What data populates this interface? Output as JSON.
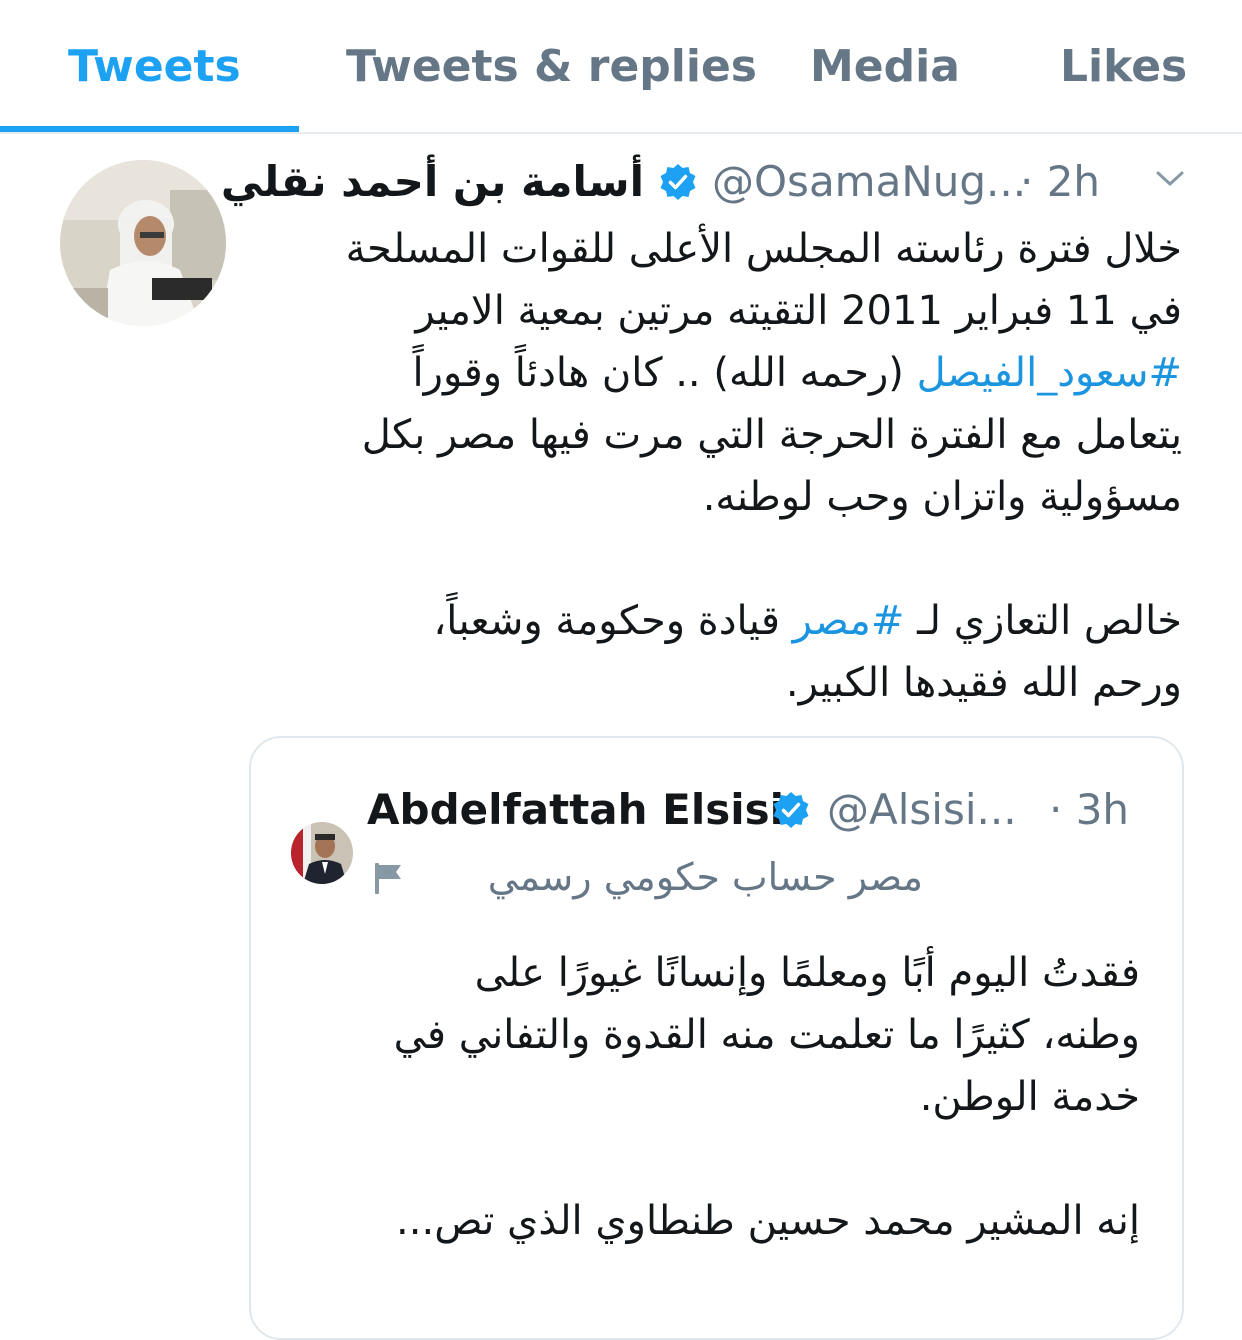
{
  "tabs": [
    {
      "label": "Tweets",
      "active": true
    },
    {
      "label": "Tweets & replies",
      "active": false
    },
    {
      "label": "Media",
      "active": false
    },
    {
      "label": "Likes",
      "active": false
    }
  ],
  "tweet": {
    "author_name": "أسامة بن أحمد نقلي",
    "verified": true,
    "handle": "@OsamaNug...",
    "time": "· 2h",
    "menu_icon": "chevron-down-icon",
    "avatar_icon": "profile-photo",
    "paragraph1": {
      "lines": [
        "خلال فترة رئاسته المجلس الأعلى للقوات المسلحة",
        "في 11 فبراير 2011 التقيته مرتين بمعية الامير"
      ],
      "hashtag": "#سعود_الفيصل",
      "after_hashtag": " (رحمه الله) .. كان هادئاً وقوراً",
      "lines_after": [
        "يتعامل مع الفترة الحرجة التي مرت فيها مصر بكل",
        "مسؤولية واتزان وحب لوطنه."
      ]
    },
    "paragraph2": {
      "before_hashtag": "خالص التعازي لـ ",
      "hashtag": "#مصر",
      "after_hashtag": " قيادة وحكومة وشعباً،",
      "line2": "ورحم الله فقيدها الكبير."
    }
  },
  "quoted_tweet": {
    "author_name": "Abdelfattah Elsisi",
    "verified": true,
    "handle": "@Alsisi...",
    "time": "· 3h",
    "label": "مصر حساب حكومي رسمي",
    "label_icon": "flag-icon",
    "avatar_icon": "profile-photo",
    "body_lines": [
      "فقدتُ اليوم أبًا ومعلمًا وإنسانًا غيورًا على",
      "وطنه، كثيرًا ما تعلمت منه القدوة والتفاني في",
      "خدمة الوطن."
    ],
    "body_line_last": "إنه المشير محمد حسين طنطاوي الذي تص..."
  },
  "colors": {
    "accent": "#1da1f2",
    "hashtag": "#1b95e0",
    "secondary_text": "#657786",
    "border": "#e1e8ed"
  }
}
